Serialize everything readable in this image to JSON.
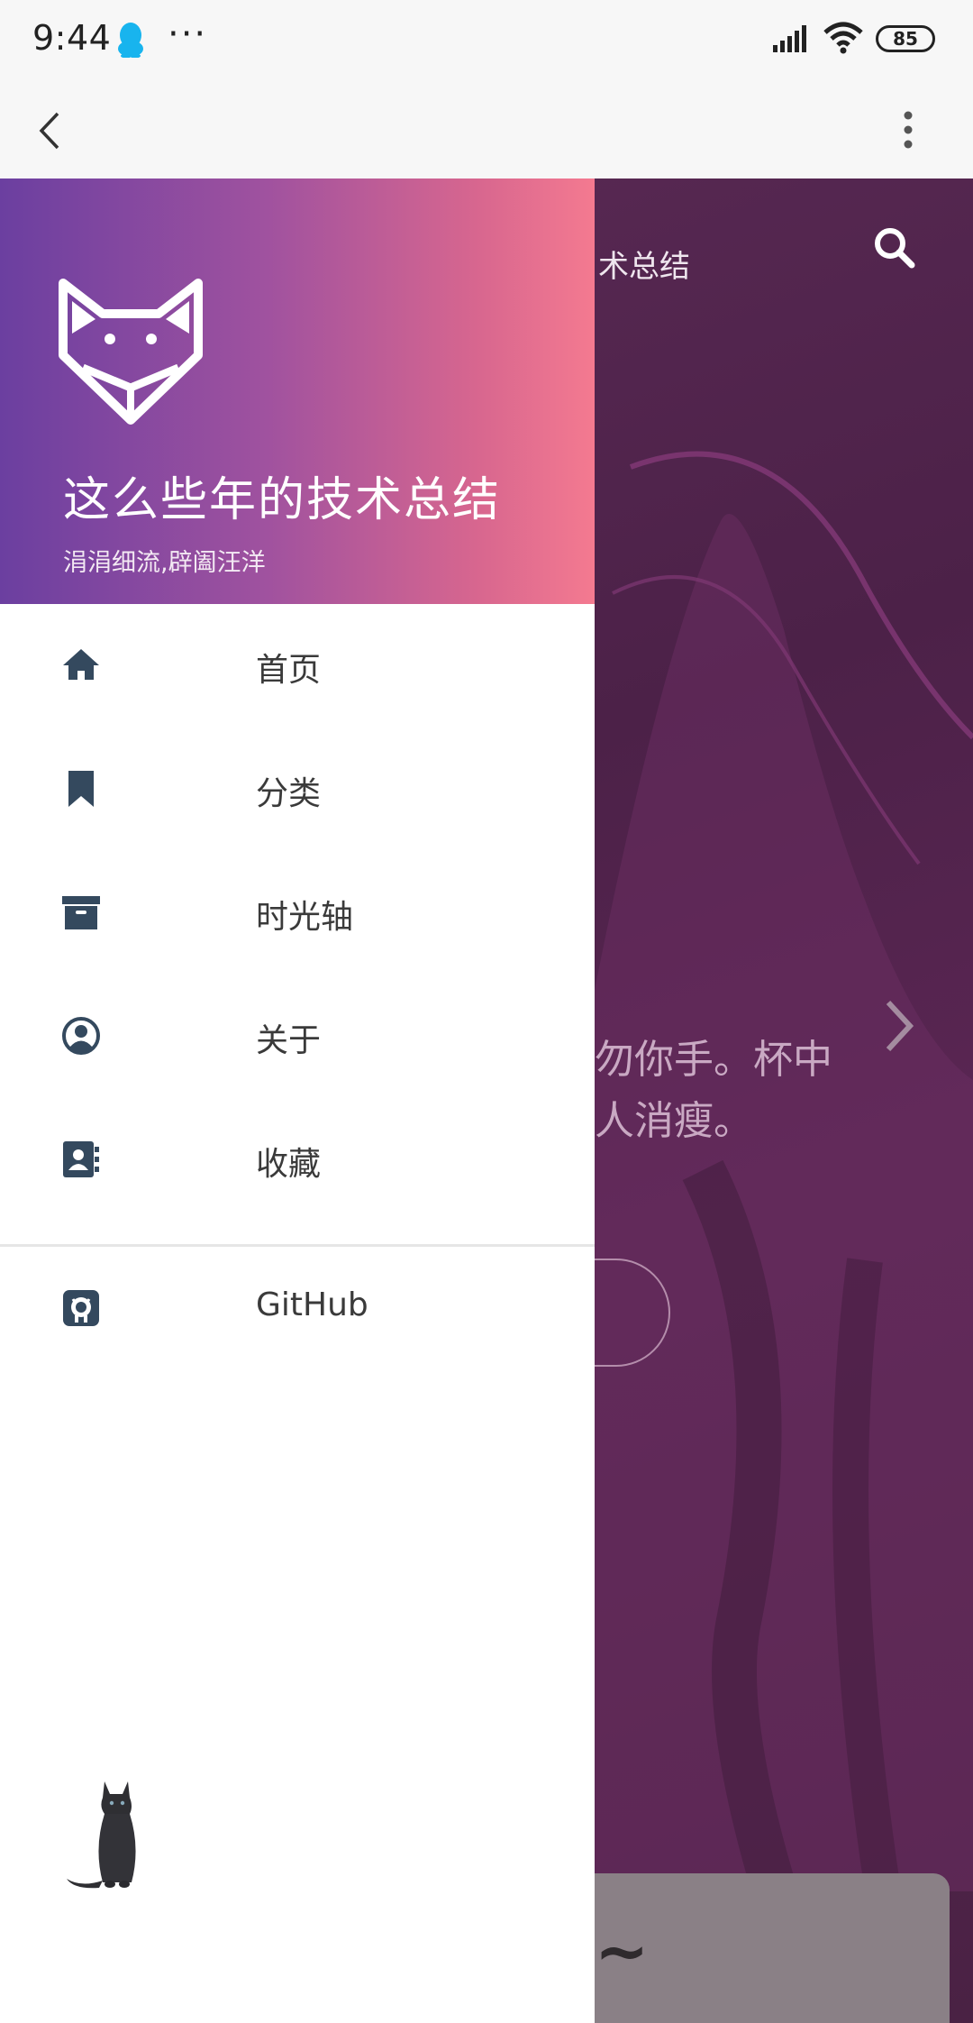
{
  "status_bar": {
    "time": "9:44",
    "battery": "85"
  },
  "page": {
    "title_fragment": "术总结",
    "quote_line1": "勿你手。杯中",
    "quote_line2": "人消瘦。",
    "card_text": "~"
  },
  "drawer": {
    "title": "这么些年的技术总结",
    "subtitle": "涓涓细流,辟阖汪洋",
    "items": [
      {
        "label": "首页",
        "icon": "home-icon"
      },
      {
        "label": "分类",
        "icon": "bookmark-icon"
      },
      {
        "label": "时光轴",
        "icon": "archive-icon"
      },
      {
        "label": "关于",
        "icon": "user-circle-icon"
      },
      {
        "label": "收藏",
        "icon": "address-book-icon"
      }
    ],
    "github_label": "GitHub"
  },
  "colors": {
    "header_gradient_start": "#6b3fa0",
    "header_gradient_end": "#f47a90",
    "icon_color": "#34495e",
    "overlay": "#4c2148"
  }
}
